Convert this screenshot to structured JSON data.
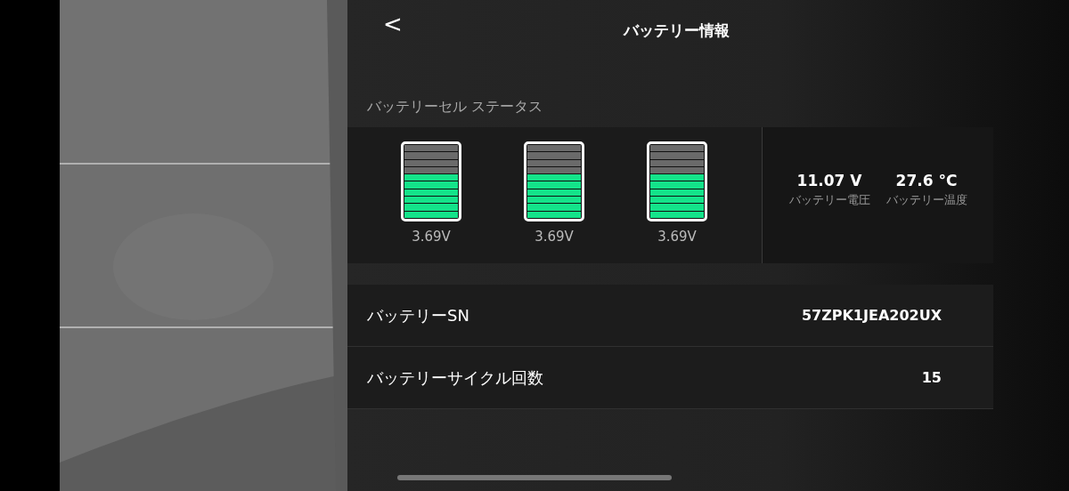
{
  "header": {
    "back": "<",
    "title": "バッテリー情報"
  },
  "cell_status": {
    "title": "バッテリーセル ステータス",
    "cells": [
      {
        "level": 0.6,
        "reading": "3.69V"
      },
      {
        "level": 0.6,
        "reading": "3.69V"
      },
      {
        "level": 0.6,
        "reading": "3.69V"
      }
    ],
    "stats": [
      {
        "value": "11.07 V",
        "label": "バッテリー電圧"
      },
      {
        "value": "27.6 °C",
        "label": "バッテリー温度"
      }
    ]
  },
  "rows": [
    {
      "label": "バッテリーSN",
      "value": "57ZPK1JEA202UX"
    },
    {
      "label": "バッテリーサイクル回数",
      "value": "15"
    }
  ]
}
